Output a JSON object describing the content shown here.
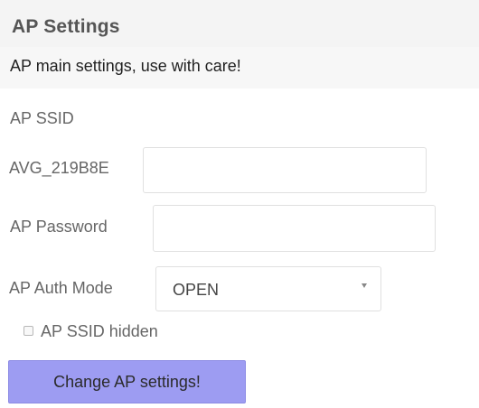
{
  "header": {
    "title": "AP Settings",
    "subtitle": "AP main settings, use with care!"
  },
  "ssid": {
    "label": "AP SSID",
    "prefix": "AVG_219B8E",
    "value": ""
  },
  "password": {
    "label": "AP Password",
    "value": ""
  },
  "auth_mode": {
    "label": "AP Auth Mode",
    "selected": "OPEN"
  },
  "ssid_hidden": {
    "label": "AP SSID hidden",
    "checked": false
  },
  "submit": {
    "label": "Change AP settings!"
  },
  "colors": {
    "button_background": "#9d9cf2",
    "header_background": "#f4f4f4",
    "text": "#555555"
  }
}
